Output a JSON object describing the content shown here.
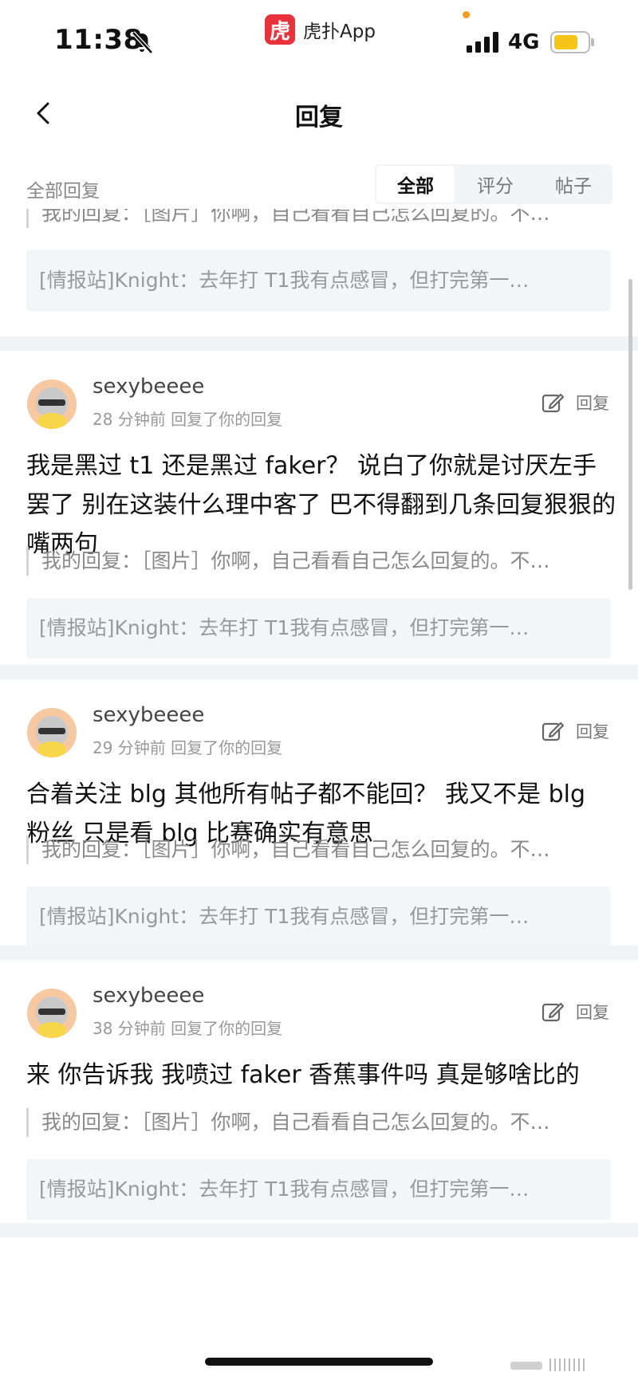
{
  "status_bar": {
    "time": "11:38",
    "app_name": "虎扑App",
    "app_logo_char": "虎",
    "network": "4G",
    "battery_color": "#f5c518",
    "icons": [
      "bell-off-icon",
      "signal-icon",
      "battery-icon"
    ]
  },
  "nav": {
    "title": "回复",
    "back_icon": "chevron-left-icon"
  },
  "filter": {
    "label": "全部回复",
    "tabs": [
      {
        "label": "全部",
        "active": true
      },
      {
        "label": "评分",
        "active": false
      },
      {
        "label": "帖子",
        "active": false
      }
    ]
  },
  "partial_item": {
    "my_reply": "我的回复：［图片］你啊，自己看看自己怎么回复的。不…",
    "quote": "[情报站]Knight：去年打 T1我有点感冒，但打完第一…"
  },
  "items": [
    {
      "username": "sexybeeee",
      "meta": "28 分钟前 回复了你的回复",
      "reply_label": "回复",
      "content": "我是黑过 t1 还是黑过 faker？ 说白了你就是讨厌左手罢了 别在这装什么理中客了 巴不得翻到几条回复狠狠的嘴两句",
      "my_reply": "我的回复：［图片］你啊，自己看看自己怎么回复的。不…",
      "quote": "[情报站]Knight：去年打 T1我有点感冒，但打完第一…"
    },
    {
      "username": "sexybeeee",
      "meta": "29 分钟前 回复了你的回复",
      "reply_label": "回复",
      "content": "合着关注 blg 其他所有帖子都不能回？ 我又不是 blg 粉丝 只是看 blg 比赛确实有意思",
      "my_reply": "我的回复：［图片］你啊，自己看看自己怎么回复的。不…",
      "quote": "[情报站]Knight：去年打 T1我有点感冒，但打完第一…"
    },
    {
      "username": "sexybeeee",
      "meta": "38 分钟前 回复了你的回复",
      "reply_label": "回复",
      "content": "来 你告诉我 我喷过 faker 香蕉事件吗 真是够啥比的",
      "my_reply": "我的回复：［图片］你啊，自己看看自己怎么回复的。不…",
      "quote": "[情报站]Knight：去年打 T1我有点感冒，但打完第一…"
    }
  ]
}
